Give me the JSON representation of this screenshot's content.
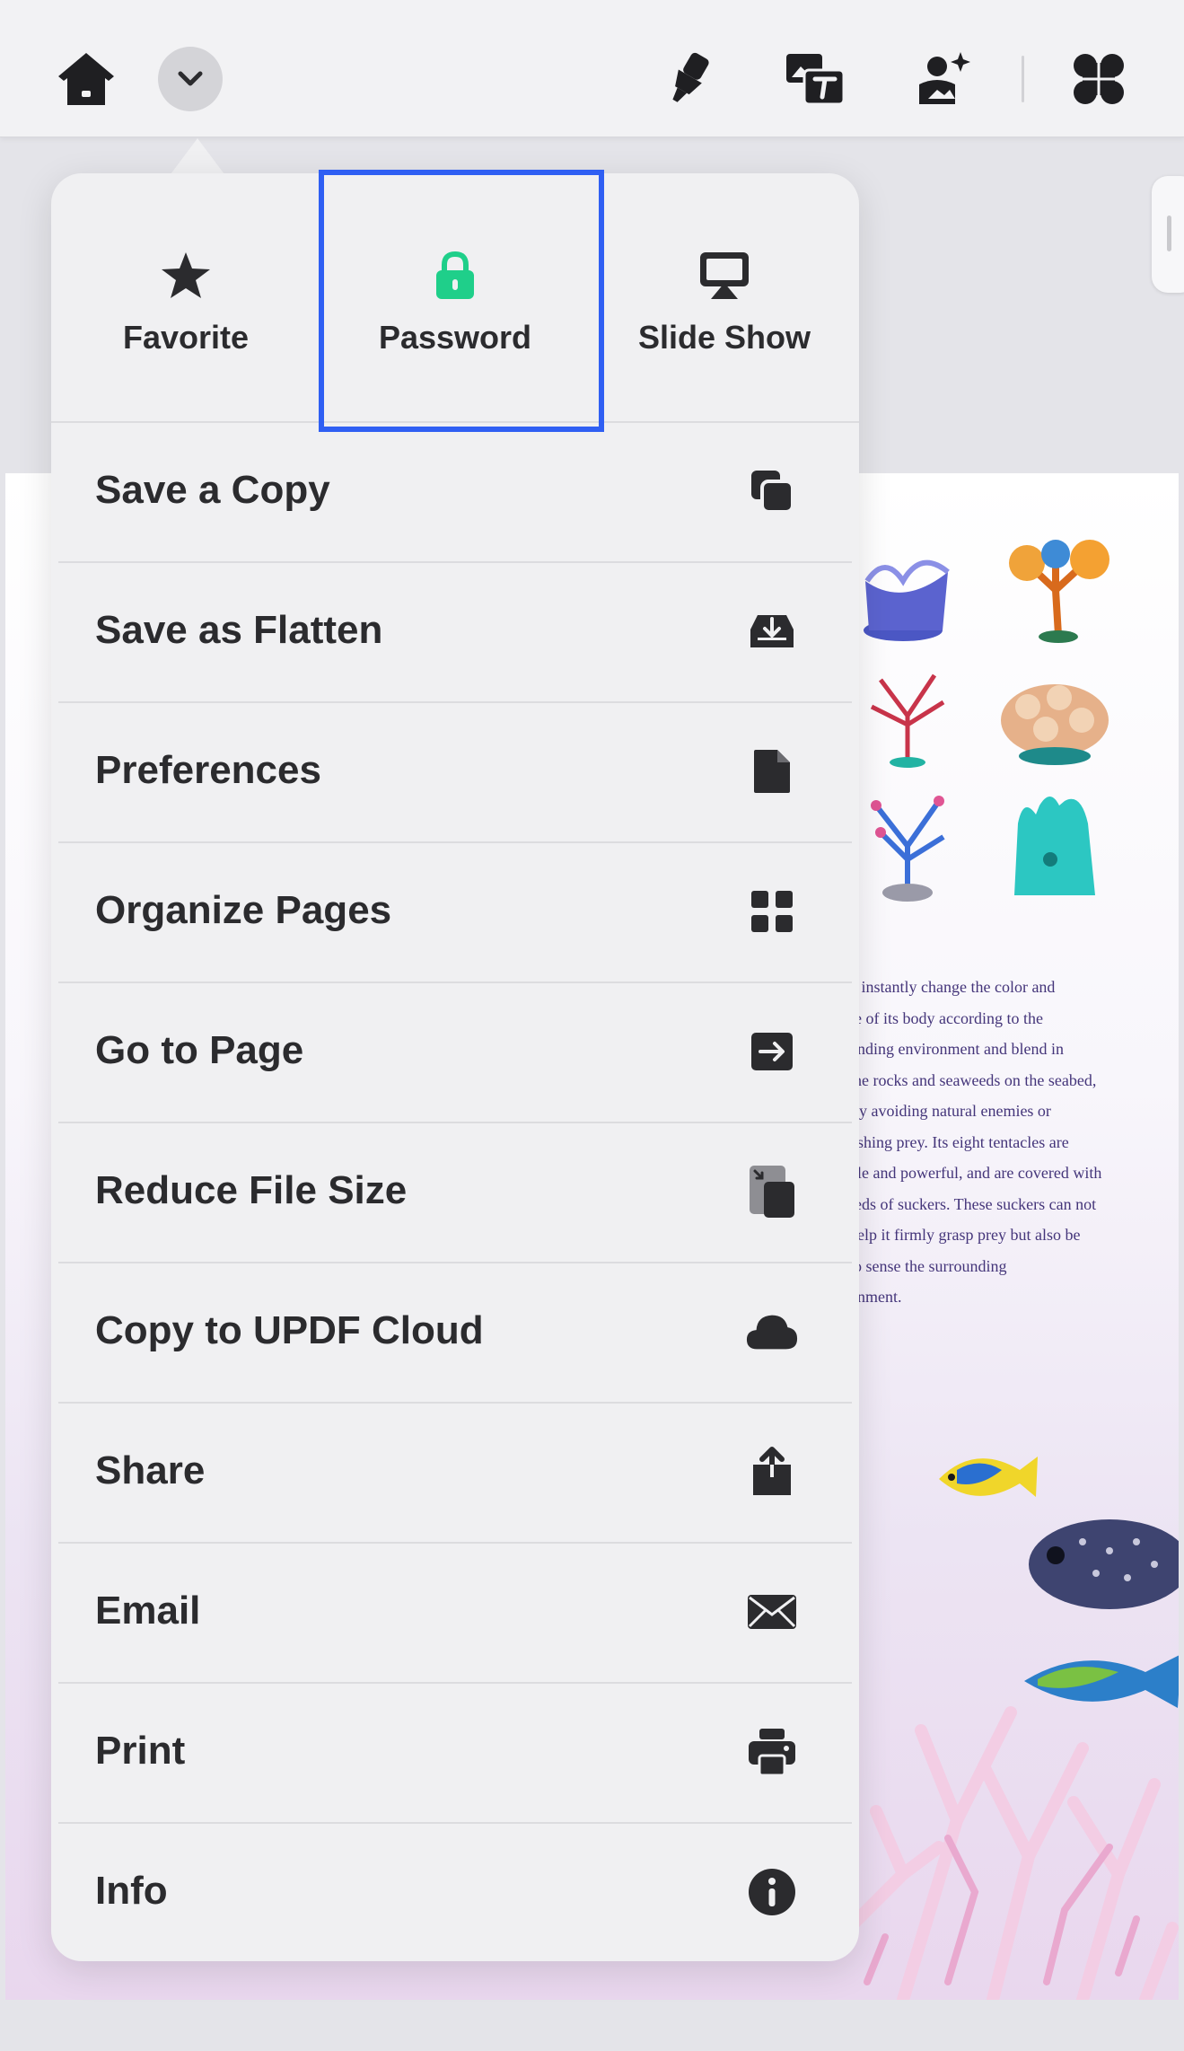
{
  "toolbar": {
    "home_icon": "home-icon",
    "dropdown_icon": "chevron-down-icon",
    "right_icons": [
      "highlighter-icon",
      "edit-text-image-icon",
      "edit-image-sparkle-icon",
      "apps-grid-icon"
    ]
  },
  "menu": {
    "top_actions": [
      {
        "label": "Favorite",
        "icon": "star-icon"
      },
      {
        "label": "Password",
        "icon": "lock-icon",
        "icon_color": "#1fcf8a"
      },
      {
        "label": "Slide Show",
        "icon": "slideshow-icon"
      }
    ],
    "items": [
      {
        "label": "Save a Copy",
        "icon": "copy-icon"
      },
      {
        "label": "Save as Flatten",
        "icon": "tray-download-icon"
      },
      {
        "label": "Preferences",
        "icon": "document-icon"
      },
      {
        "label": "Organize Pages",
        "icon": "grid-icon"
      },
      {
        "label": "Go to Page",
        "icon": "arrow-right-box-icon"
      },
      {
        "label": "Reduce File Size",
        "icon": "compress-file-icon"
      },
      {
        "label": "Copy to UPDF Cloud",
        "icon": "cloud-icon"
      },
      {
        "label": "Share",
        "icon": "share-icon"
      },
      {
        "label": "Email",
        "icon": "envelope-icon"
      },
      {
        "label": "Print",
        "icon": "printer-icon"
      },
      {
        "label": "Info",
        "icon": "info-icon"
      }
    ]
  },
  "document": {
    "text_lines": [
      "n instantly change the color and",
      "re of its body according to the",
      "unding environment and blend in",
      "the rocks and seaweeds on the seabed,",
      "rly avoiding natural enemies or",
      "ushing prey. Its eight tentacles are",
      "ble and powerful, and are covered with",
      "reds of suckers. These suckers can not",
      "help it firmly grasp prey but also be",
      "to sense the surrounding",
      "onment."
    ]
  },
  "colors": {
    "accent_highlight": "#2f5ff3",
    "lock_green": "#1fcf8a",
    "text_dark": "#2b2b2e",
    "doc_text": "#44357a"
  }
}
